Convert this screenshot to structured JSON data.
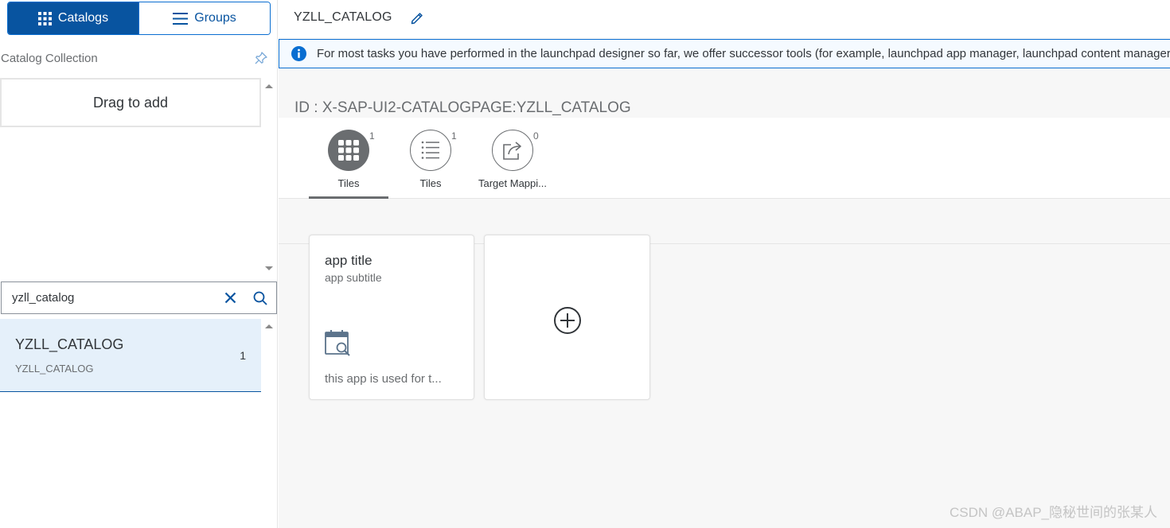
{
  "left_panel": {
    "segment": {
      "catalogs_label": "Catalogs",
      "groups_label": "Groups"
    },
    "collection_label": "Catalog Collection",
    "drop_area_text": "Drag to add",
    "search": {
      "value": "yzll_catalog"
    },
    "list": [
      {
        "title": "YZLL_CATALOG",
        "subtitle": "YZLL_CATALOG",
        "count": "1"
      }
    ]
  },
  "header": {
    "title": "YZLL_CATALOG"
  },
  "info_strip": {
    "text": "For most tasks you have performed in the launchpad designer so far, we offer successor tools (for example, launchpad app manager, launchpad content manager)."
  },
  "catalog": {
    "id_line": "ID : X-SAP-UI2-CATALOGPAGE:YZLL_CATALOG"
  },
  "tabs": [
    {
      "label": "Tiles",
      "count": "1",
      "icon": "grid-icon"
    },
    {
      "label": "Tiles",
      "count": "1",
      "icon": "list-icon"
    },
    {
      "label": "Target Mappi...",
      "count": "0",
      "icon": "share-icon"
    }
  ],
  "tile": {
    "title": "app title",
    "subtitle": "app subtitle",
    "icon": "calendar-search-icon",
    "footer": "this app is used for t..."
  },
  "add_tile": {
    "icon": "add-circle-icon"
  },
  "watermark": "CSDN @ABAP_隐秘世间的张某人",
  "colors": {
    "brand": "#0854a0",
    "accent": "#0a6ed1",
    "selected_row": "#e5f0fa",
    "canvas": "#f7f7f7"
  }
}
